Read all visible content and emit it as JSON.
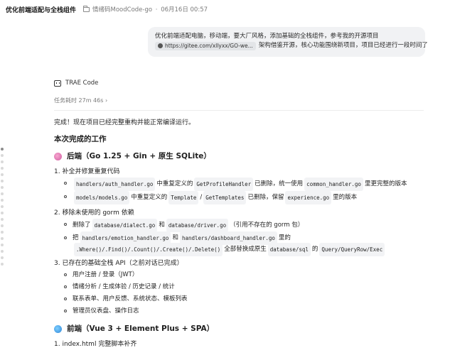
{
  "header": {
    "title": "优化前端适配与全栈组件",
    "meta_repo": "情绪码MoodCode-go",
    "meta_sep": "·",
    "meta_time": "06月16日 00:57"
  },
  "user_message": {
    "line1": "优化前端适配电脑，移动端，要大厂风格，添加基础的全栈组件，参考我的开源项目",
    "link_chip": "https://gitee.com/xllyxx/GO-we...",
    "line2_rest": "架构借鉴开源，核心功能围绕新项目，项目已经进行一段时间了"
  },
  "assistant": {
    "name": "TRAE Code",
    "duration": "任务耗时 27m 46s",
    "chevron": "›",
    "intro": "完成！现在项目已经完整重构并能正常编译运行。",
    "section_title": "本次完成的工作",
    "backend_title": "后端（Go 1.25 + Gin + 原生 SQLite）",
    "items": [
      {
        "number": "1.",
        "label": "补全并修复重复代码"
      },
      {
        "number": "2.",
        "label": "移除未使用的 gorm 依赖"
      },
      {
        "number": "3.",
        "label": "已存在的基础全栈 API（之前对话已完成）"
      }
    ],
    "item1": {
      "b1": {
        "c1": "handlers/auth_handler.go",
        "t1": "中重复定义的",
        "c2": "GetProfileHandler",
        "t2": "已删除，统一使用",
        "c3": "common_handler.go",
        "t3": "里更完整的版本"
      },
      "b2": {
        "c1": "models/models.go",
        "t1": "中重复定义的",
        "c2": "Template",
        "t2": "/",
        "c3": "GetTemplates",
        "t3": "已删除，保留",
        "c4": "experience.go",
        "t4": "里的版本"
      }
    },
    "item2": {
      "b1": {
        "t1": "删除了",
        "c1": "database/dialect.go",
        "t2": "和",
        "c2": "database/driver.go",
        "t3": "（引用不存在的 gorm 包）"
      },
      "b2": {
        "t1": "把",
        "c1": "handlers/emotion_handler.go",
        "t2": "和",
        "c2": "handlers/dashboard_handler.go",
        "t3": "里的",
        "c3": ".Where()/.Find()/.Count()/.Create()/.Delete()",
        "t4": "全部替换成原生",
        "c4": "database/sql",
        "t5": "的",
        "c5": "Query/QueryRow/Exec"
      }
    },
    "item3": [
      "用户注册 / 登录（JWT）",
      "情绪分析 / 生成体验 / 历史记录 / 统计",
      "联系表单、用户反馈、系统状态、模板列表",
      "管理员仪表盘、操作日志"
    ],
    "frontend_title": "前端（Vue 3 + Element Plus + SPA）",
    "frontend_item1": {
      "number": "1.",
      "label": "index.html 完整脚本补齐"
    }
  }
}
